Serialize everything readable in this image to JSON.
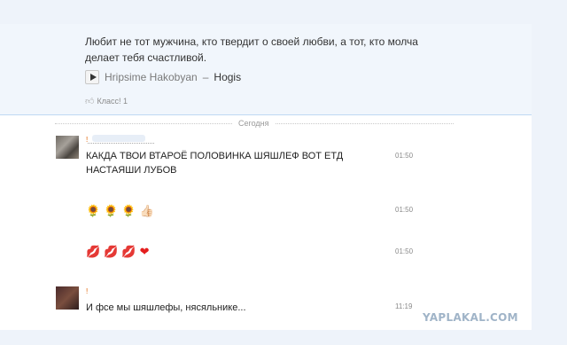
{
  "post": {
    "quote_line1": "Любит не тот мужчина, кто твердит о своей любви, а тот, кто молча",
    "quote_line2": "делает тебя счастливой.",
    "track_artist": "Hripsime Hakobyan",
    "track_separator": "–",
    "track_title": "Hogis",
    "like_label": "Класс! 1",
    "like_icon": "thumbs-up-icon"
  },
  "chat": {
    "date_divider": "Сегодня",
    "messages": [
      {
        "sender": "!",
        "text_line1": "КАКДА ТВОИ ВТАРОЁ ПОЛОВИНКА ШЯШЛЕФ ВОТ ЕТД",
        "text_line2": "НАСТАЯШИ ЛУБОВ",
        "time": "01:50"
      },
      {
        "emoji": [
          "🌻",
          "🌻",
          "🌻",
          "👍🏻"
        ],
        "time": "01:50"
      },
      {
        "emoji": [
          "💋",
          "💋",
          "💋",
          "❤"
        ],
        "time": "01:50"
      },
      {
        "sender": "!",
        "text": "И фсе мы шяшлефы, нясяльнике...",
        "time": "11:19"
      }
    ]
  },
  "watermark": "YAPLAKAL.COM",
  "colors": {
    "accent_link": "#e06000",
    "divider_blue": "#bfd9f3",
    "page_bg": "#eef3fa"
  }
}
